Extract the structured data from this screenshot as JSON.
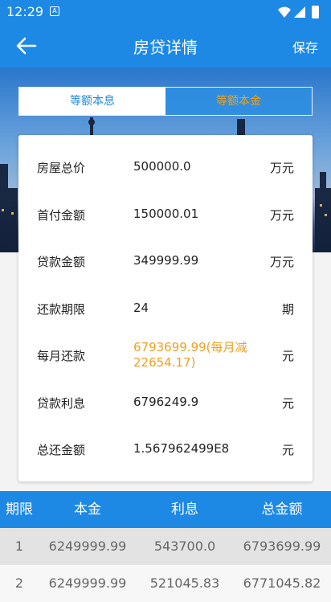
{
  "status": {
    "time": "12:29",
    "notification_glyph": "A"
  },
  "appbar": {
    "title": "房贷详情",
    "save_label": "保存"
  },
  "tabs": [
    {
      "label": "等额本息",
      "active": true
    },
    {
      "label": "等额本金",
      "active": false
    }
  ],
  "details": {
    "total_price": {
      "label": "房屋总价",
      "value": "500000.0",
      "unit": "万元"
    },
    "down_payment": {
      "label": "首付金额",
      "value": "150000.01",
      "unit": "万元"
    },
    "loan_amount": {
      "label": "贷款金额",
      "value": "349999.99",
      "unit": "万元"
    },
    "term": {
      "label": "还款期限",
      "value": "24",
      "unit": "期"
    },
    "monthly": {
      "label": "每月还款",
      "value_line1": "6793699.99(每月减",
      "value_line2": "22654.17)",
      "unit": "元"
    },
    "interest": {
      "label": "贷款利息",
      "value": "6796249.9",
      "unit": "元"
    },
    "total_repay": {
      "label": "总还金额",
      "value": "1.567962499E8",
      "unit": "元"
    }
  },
  "table": {
    "headers": [
      "期限",
      "本金",
      "利息",
      "总金额"
    ],
    "rows": [
      [
        "1",
        "6249999.99",
        "543700.0",
        "6793699.99"
      ],
      [
        "2",
        "6249999.99",
        "521045.83",
        "6771045.82"
      ]
    ]
  },
  "colors": {
    "primary": "#1e88e5",
    "accent_orange": "#f0a020"
  },
  "icons": {
    "back": "arrow-left-icon",
    "wifi": "wifi-icon",
    "signal": "signal-icon",
    "battery": "battery-icon"
  }
}
